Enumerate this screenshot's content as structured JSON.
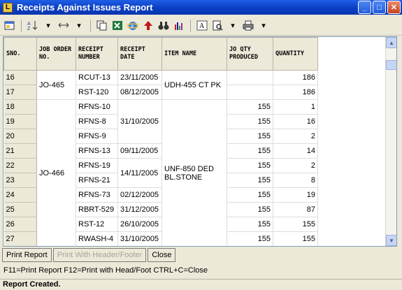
{
  "window": {
    "title": "Receipts Against Issues Report",
    "app_icon": "L"
  },
  "toolbar": {
    "icons": [
      "window-icon",
      "sort-icon",
      "dropdown-arrow",
      "column-width-icon",
      "dropdown-arrow",
      "copy-icon",
      "excel-icon",
      "ie-icon",
      "arrow-up-icon",
      "find-icon",
      "chart-icon",
      "font-icon",
      "print-preview-icon",
      "dropdown-arrow",
      "printer-icon",
      "dropdown-arrow"
    ]
  },
  "grid": {
    "columns": [
      "SNO.",
      "JOB ORDER NO.",
      "RECEIPT NUMBER",
      "RECEIPT DATE",
      "ITEM NAME",
      "JO QTY PRODUCED",
      "QUANTITY"
    ],
    "rows": [
      {
        "sno": "16",
        "receipt": "RCUT-13",
        "date": "23/11/2005",
        "qty_prod": "",
        "qty": "186"
      },
      {
        "sno": "17",
        "receipt": "RST-120",
        "date": "08/12/2005",
        "qty_prod": "",
        "qty": "186"
      },
      {
        "sno": "18",
        "receipt": "RFNS-10",
        "date": "",
        "qty_prod": "155",
        "qty": "1"
      },
      {
        "sno": "19",
        "receipt": "RFNS-8",
        "date": "31/10/2005",
        "qty_prod": "155",
        "qty": "16"
      },
      {
        "sno": "20",
        "receipt": "RFNS-9",
        "date": "",
        "qty_prod": "155",
        "qty": "2"
      },
      {
        "sno": "21",
        "receipt": "RFNS-13",
        "date": "09/11/2005",
        "qty_prod": "155",
        "qty": "14"
      },
      {
        "sno": "22",
        "receipt": "RFNS-19",
        "date": "14/11/2005",
        "qty_prod": "155",
        "qty": "2"
      },
      {
        "sno": "23",
        "receipt": "RFNS-21",
        "date": "",
        "qty_prod": "155",
        "qty": "8"
      },
      {
        "sno": "24",
        "receipt": "RFNS-73",
        "date": "02/12/2005",
        "qty_prod": "155",
        "qty": "19"
      },
      {
        "sno": "25",
        "receipt": "RBRT-529",
        "date": "31/12/2005",
        "qty_prod": "155",
        "qty": "87"
      },
      {
        "sno": "26",
        "receipt": "RST-12",
        "date": "26/10/2005",
        "qty_prod": "155",
        "qty": "155"
      },
      {
        "sno": "27",
        "receipt": "RWASH-4",
        "date": "31/10/2005",
        "qty_prod": "155",
        "qty": "155"
      }
    ],
    "groups": [
      {
        "job_order": "JO-465",
        "item": "UDH-455 CT PK"
      },
      {
        "job_order": "JO-466",
        "item": "UNF-850 DED BL.STONE"
      }
    ]
  },
  "buttons": {
    "print": "Print Report",
    "print_header": "Print With Header/Footer",
    "close": "Close"
  },
  "hint": "F11=Print Report  F12=Print with Head/Foot  CTRL+C=Close",
  "status": "Report Created."
}
